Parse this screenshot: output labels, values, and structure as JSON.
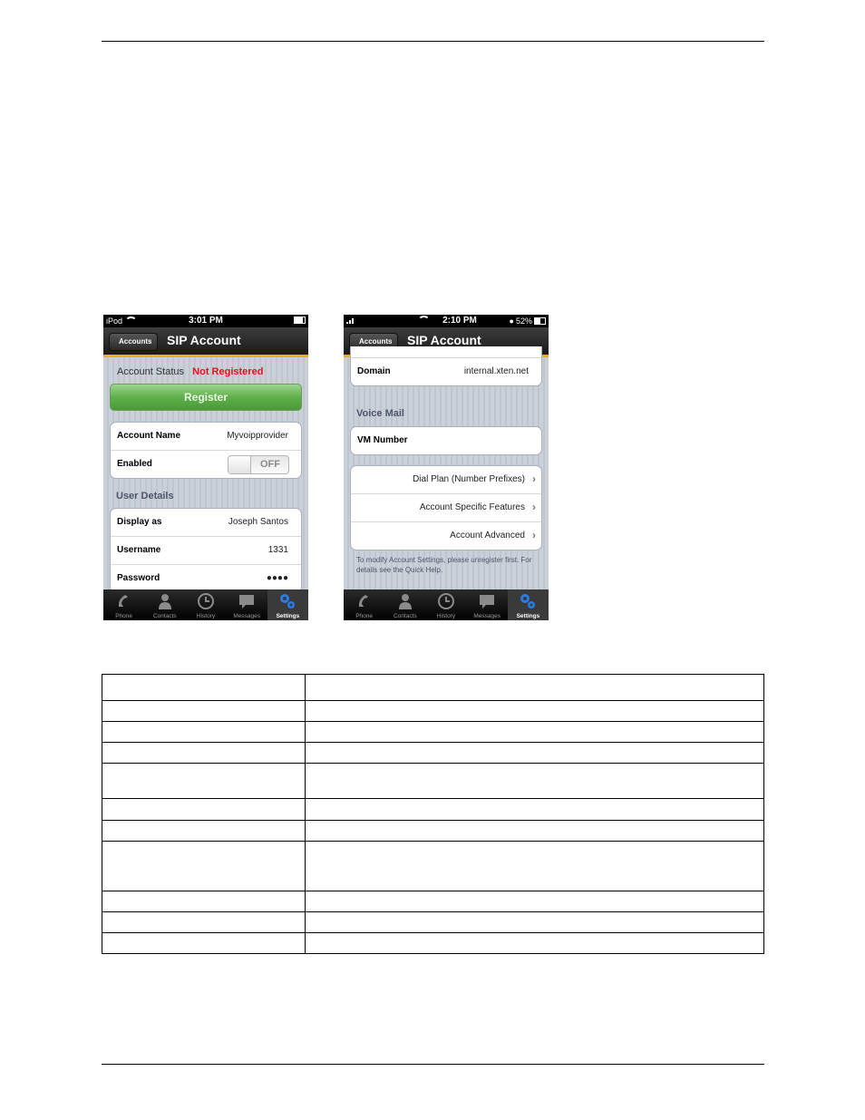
{
  "screen1": {
    "status_bar": {
      "carrier": "iPod",
      "time": "3:01 PM",
      "battery_level": 0.8
    },
    "nav": {
      "back_label": "Accounts",
      "title": "SIP Account"
    },
    "account_status_label": "Account Status",
    "account_status_value": "Not Registered",
    "register_label": "Register",
    "account_group": [
      {
        "label": "Account Name",
        "value": "Myvoipprovider"
      },
      {
        "label": "Enabled",
        "toggle": "OFF"
      }
    ],
    "user_details_header": "User Details",
    "user_group": [
      {
        "label": "Display as",
        "value": "Joseph Santos"
      },
      {
        "label": "Username",
        "value": "1331"
      },
      {
        "label": "Password",
        "value": "●●●●"
      }
    ]
  },
  "screen2": {
    "status_bar": {
      "time": "2:10 PM",
      "battery_text": "52%",
      "battery_level": 0.52
    },
    "nav": {
      "back_label": "Accounts",
      "title": "SIP Account"
    },
    "domain": {
      "label": "Domain",
      "value": "internal.xten.net"
    },
    "voice_mail_header": "Voice Mail",
    "vm_number_label": "VM Number",
    "nav_items": [
      {
        "label": "Dial Plan (Number Prefixes)"
      },
      {
        "label": "Account Specific Features"
      },
      {
        "label": "Account Advanced"
      }
    ],
    "footnote": "To modify Account Settings, please unregister first.  For details see the Quick Help."
  },
  "tabbar": {
    "items": [
      {
        "label": "Phone",
        "icon": "phone-icon"
      },
      {
        "label": "Contacts",
        "icon": "contacts-icon"
      },
      {
        "label": "History",
        "icon": "clock-icon"
      },
      {
        "label": "Messages",
        "icon": "message-bubble-icon"
      },
      {
        "label": "Settings",
        "icon": "gears-icon",
        "active": true
      }
    ]
  },
  "table": {
    "rows": [
      [
        "",
        ""
      ],
      [
        "",
        ""
      ],
      [
        "",
        ""
      ],
      [
        "",
        ""
      ],
      [
        "",
        ""
      ],
      [
        "",
        ""
      ],
      [
        "",
        ""
      ],
      [
        "",
        ""
      ],
      [
        "",
        ""
      ],
      [
        "",
        ""
      ],
      [
        "",
        ""
      ]
    ]
  }
}
